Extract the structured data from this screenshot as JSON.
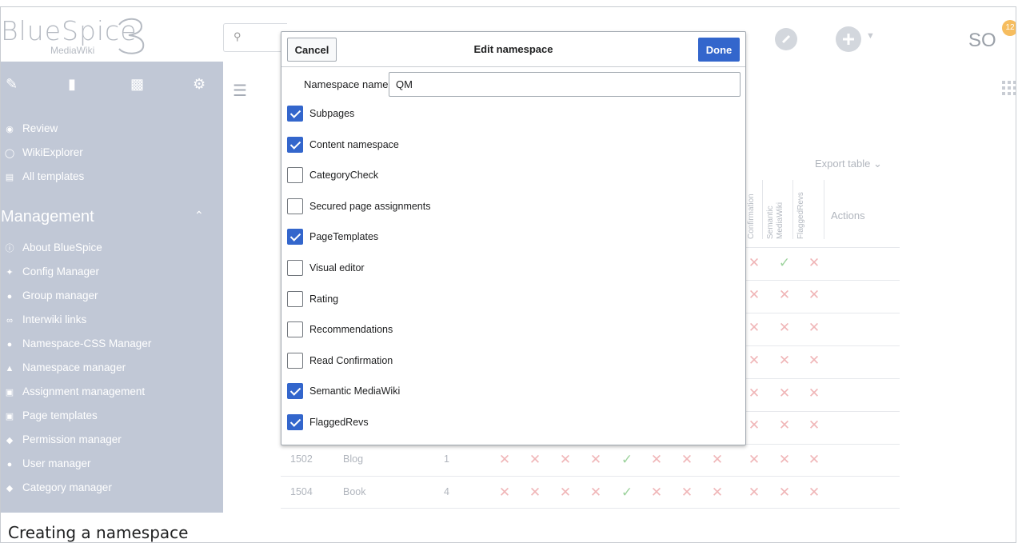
{
  "header": {
    "logo_main": "BlueSpice",
    "logo_version": "3",
    "logo_sub": "MediaWiki",
    "search_icon": "search-icon",
    "user_initials": "SO",
    "notification_count": "12"
  },
  "sidebar": {
    "tab_icons": [
      "pencil-icon",
      "document-icon",
      "clipboard-icon",
      "gear-icon"
    ],
    "top_links": [
      {
        "icon": "eye-icon",
        "label": "Review"
      },
      {
        "icon": "explorer-icon",
        "label": "WikiExplorer"
      },
      {
        "icon": "template-icon",
        "label": "All templates"
      }
    ],
    "management_heading": "Management",
    "management_links": [
      {
        "icon": "info-icon",
        "label": "About BlueSpice"
      },
      {
        "icon": "wrench-icon",
        "label": "Config Manager"
      },
      {
        "icon": "group-icon",
        "label": "Group manager"
      },
      {
        "icon": "link-icon",
        "label": "Interwiki links"
      },
      {
        "icon": "css-icon",
        "label": "Namespace-CSS Manager"
      },
      {
        "icon": "namespace-icon",
        "label": "Namespace manager"
      },
      {
        "icon": "assignment-icon",
        "label": "Assignment management"
      },
      {
        "icon": "page-template-icon",
        "label": "Page templates"
      },
      {
        "icon": "key-icon",
        "label": "Permission manager"
      },
      {
        "icon": "user-icon",
        "label": "User manager"
      },
      {
        "icon": "tag-icon",
        "label": "Category manager"
      }
    ]
  },
  "table": {
    "export_label": "Export table",
    "vertical_headers": [
      "Confirmation",
      "Semantic MediaWiki",
      "FlaggedRevs"
    ],
    "actions_header": "Actions",
    "right_rows": [
      [
        "x",
        "check",
        "x"
      ],
      [
        "x",
        "x",
        "x"
      ],
      [
        "x",
        "x",
        "x"
      ],
      [
        "x",
        "x",
        "x"
      ],
      [
        "x",
        "x",
        "x"
      ],
      [
        "x",
        "x",
        "x"
      ]
    ],
    "full_rows": [
      {
        "id": "1502",
        "name": "Blog",
        "pages": "1",
        "flags": [
          "x",
          "x",
          "x",
          "x",
          "check",
          "x",
          "x",
          "x",
          "x",
          "x",
          "x"
        ]
      },
      {
        "id": "1504",
        "name": "Book",
        "pages": "4",
        "flags": [
          "x",
          "x",
          "x",
          "x",
          "check",
          "x",
          "x",
          "x",
          "x",
          "x",
          "x"
        ]
      }
    ]
  },
  "dialog": {
    "cancel_label": "Cancel",
    "title": "Edit namespace",
    "done_label": "Done",
    "ns_name_label": "Namespace name:",
    "ns_name_value": "QM",
    "options": [
      {
        "label": "Subpages",
        "checked": true
      },
      {
        "label": "Content namespace",
        "checked": true
      },
      {
        "label": "CategoryCheck",
        "checked": false
      },
      {
        "label": "Secured page assignments",
        "checked": false
      },
      {
        "label": "PageTemplates",
        "checked": true
      },
      {
        "label": "Visual editor",
        "checked": false
      },
      {
        "label": "Rating",
        "checked": false
      },
      {
        "label": "Recommendations",
        "checked": false
      },
      {
        "label": "Read Confirmation",
        "checked": false
      },
      {
        "label": "Semantic MediaWiki",
        "checked": true
      },
      {
        "label": "FlaggedRevs",
        "checked": true
      }
    ]
  },
  "caption": "Creating a namespace",
  "colors": {
    "sidebar_bg": "#c1c8d6",
    "accent": "#3366cc",
    "cross": "#f0b6b8",
    "check": "#9ed39e"
  }
}
